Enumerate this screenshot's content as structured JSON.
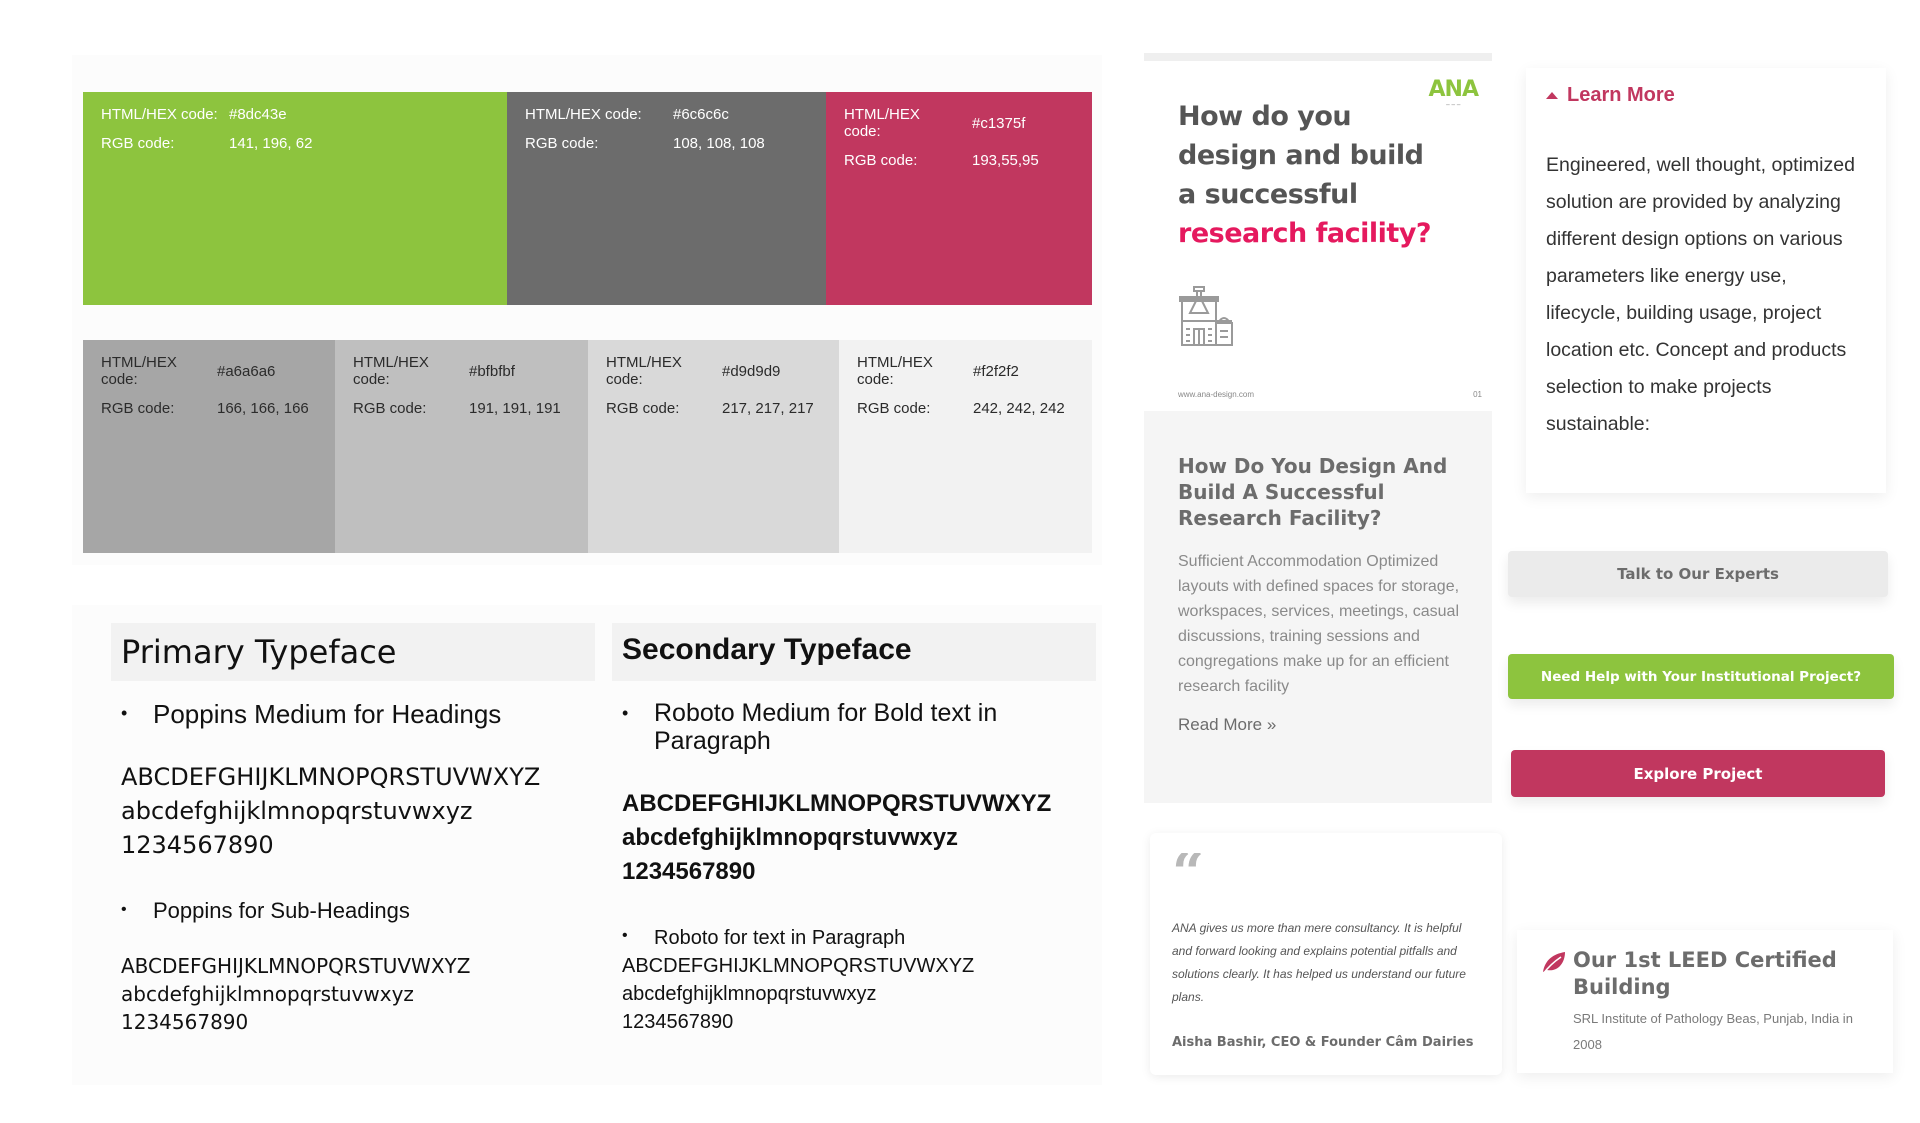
{
  "palette": {
    "primary": [
      {
        "name": "green",
        "hex_label": "HTML/HEX code:",
        "hex": "#8dc43e",
        "rgb_label": "RGB code:",
        "rgb": "141, 196, 62",
        "color": "#8dc43e",
        "text": "light"
      },
      {
        "name": "dark-gray",
        "hex_label": "HTML/HEX code:",
        "hex": "#6c6c6c",
        "rgb_label": "RGB code:",
        "rgb": "108, 108, 108",
        "color": "#6c6c6c",
        "text": "light"
      },
      {
        "name": "pink",
        "hex_label": "HTML/HEX code:",
        "hex": "#c1375f",
        "rgb_label": "RGB code:",
        "rgb": "193,55,95",
        "color": "#c1375f",
        "text": "light"
      }
    ],
    "secondary": [
      {
        "name": "gray-a6",
        "hex_label": "HTML/HEX code:",
        "hex": "#a6a6a6",
        "rgb_label": "RGB code:",
        "rgb": "166, 166, 166",
        "color": "#a6a6a6",
        "text": "dark"
      },
      {
        "name": "gray-bf",
        "hex_label": "HTML/HEX code:",
        "hex": "#bfbfbf",
        "rgb_label": "RGB code:",
        "rgb": "191, 191, 191",
        "color": "#bfbfbf",
        "text": "dark"
      },
      {
        "name": "gray-d9",
        "hex_label": "HTML/HEX code:",
        "hex": "#d9d9d9",
        "rgb_label": "RGB code:",
        "rgb": "217, 217, 217",
        "color": "#d9d9d9",
        "text": "dark"
      },
      {
        "name": "gray-f2",
        "hex_label": "HTML/HEX code:",
        "hex": "#f2f2f2",
        "rgb_label": "RGB code:",
        "rgb": "242, 242, 242",
        "color": "#f2f2f2",
        "text": "dark"
      }
    ]
  },
  "typefaces": {
    "primary": {
      "title": "Primary Typeface",
      "heading_rule": "Poppins Medium for Headings",
      "heading_sample": [
        "ABCDEFGHIJKLMNOPQRSTUVWXYZ",
        "abcdefghijklmnopqrstuvwxyz",
        "1234567890"
      ],
      "sub_rule": "Poppins for Sub-Headings",
      "sub_sample": [
        "ABCDEFGHIJKLMNOPQRSTUVWXYZ",
        "abcdefghijklmnopqrstuvwxyz",
        "1234567890"
      ]
    },
    "secondary": {
      "title": "Secondary Typeface",
      "heading_rule": "Roboto Medium for Bold text in Paragraph",
      "heading_sample": [
        "ABCDEFGHIJKLMNOPQRSTUVWXYZ",
        "abcdefghijklmnopqrstuvwxyz",
        "1234567890"
      ],
      "sub_rule": "Roboto for text in Paragraph",
      "sub_sample": [
        "ABCDEFGHIJKLMNOPQRSTUVWXYZ",
        "abcdefghijklmnopqrstuvwxyz",
        "1234567890"
      ]
    },
    "bullet": "•"
  },
  "blog": {
    "image": {
      "logo": "ANA",
      "headline_lines": [
        "How do you",
        "design and build",
        "a successful"
      ],
      "headline_accent": "research facility?",
      "icon": "lab-building-icon",
      "url": "www.ana-design.com",
      "page": "01"
    },
    "title": "How Do You Design And Build A Successful Research Facility?",
    "excerpt": "Sufficient Accommodation Optimized layouts with defined spaces for storage, workspaces, services, meetings, casual discussions, training sessions and congregations make up for an efficient research facility",
    "read_more": "Read More »"
  },
  "testimonial": {
    "quote_icon": "“",
    "text": "ANA gives us more than mere consultancy. It is helpful and forward looking and explains potential pitfalls and solutions clearly. It has helped us understand our future plans.",
    "author": "Aisha Bashir, CEO & Founder Câm Dairies"
  },
  "learn_more": {
    "label": "Learn More",
    "text": "Engineered, well thought, optimized solution are provided by analyzing different design options on various parameters like energy use, lifecycle, building usage, project location etc. Concept and products selection to make projects sustainable:"
  },
  "buttons": {
    "talk": "Talk to Our Experts",
    "help": "Need Help with Your Institutional Project?",
    "explore": "Explore Project"
  },
  "leed": {
    "icon": "leaf-icon",
    "title": "Our 1st LEED Certified Building",
    "subtitle": "SRL Institute of Pathology Beas, Punjab, India in 2008"
  },
  "colors": {
    "brand_green": "#8dc43e",
    "brand_gray": "#6c6c6c",
    "brand_pink": "#c1375f",
    "headline_accent": "#e5195e"
  }
}
